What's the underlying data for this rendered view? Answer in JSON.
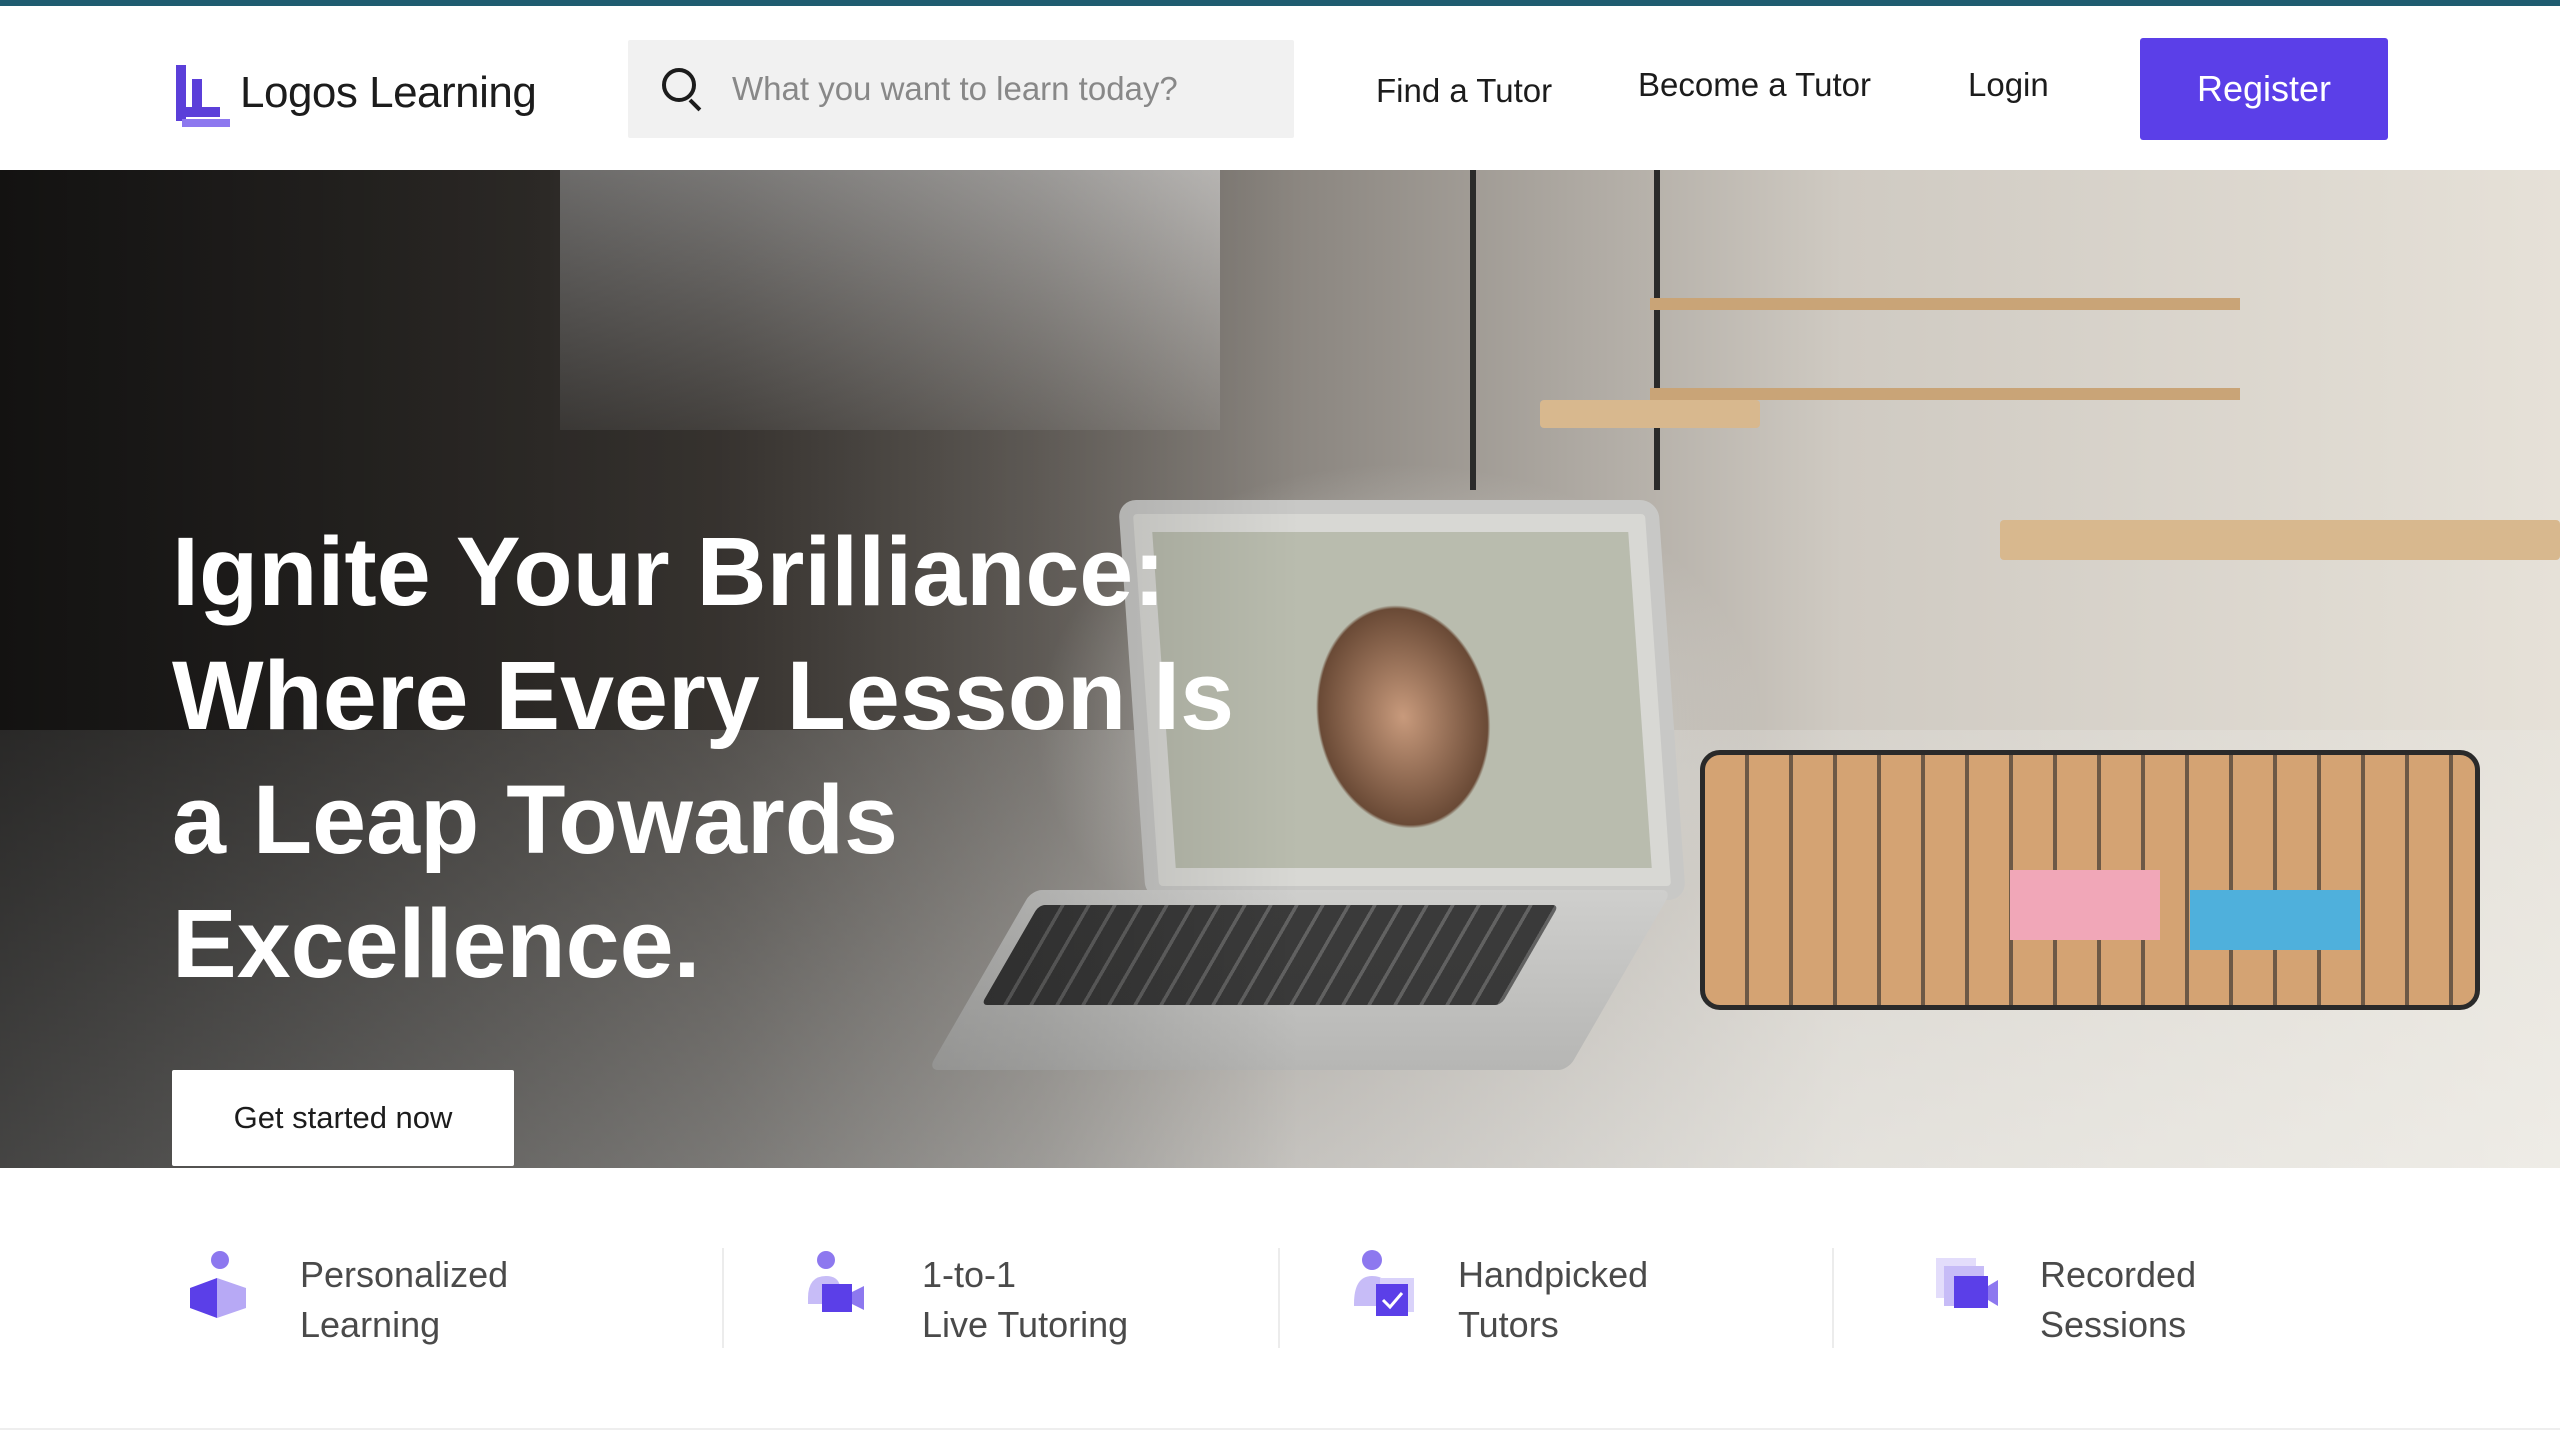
{
  "header": {
    "logo_text": "Logos Learning",
    "search": {
      "placeholder": "What you want to learn today?",
      "value": ""
    },
    "nav": {
      "find_tutor": "Find a Tutor",
      "become_tutor": "Become a Tutor",
      "login": "Login"
    },
    "register_label": "Register"
  },
  "hero": {
    "title_lines": [
      "Ignite Your Brilliance:",
      "Where Every Lesson Is",
      "a Leap Towards",
      "Excellence."
    ],
    "cta_label": "Get started now"
  },
  "features": [
    {
      "icon": "personalized-learning-icon",
      "lines": [
        "Personalized",
        "Learning"
      ]
    },
    {
      "icon": "live-tutoring-icon",
      "lines": [
        "1-to-1",
        "Live Tutoring"
      ]
    },
    {
      "icon": "handpicked-tutors-icon",
      "lines": [
        "Handpicked",
        "Tutors"
      ]
    },
    {
      "icon": "recorded-sessions-icon",
      "lines": [
        "Recorded",
        "Sessions"
      ]
    }
  ],
  "colors": {
    "brand": "#5b3fe8",
    "brand_light": "#8d78ef",
    "top_border": "#1f5c70",
    "text": "#1c1c1c",
    "feature_text": "#4a4a4a"
  }
}
